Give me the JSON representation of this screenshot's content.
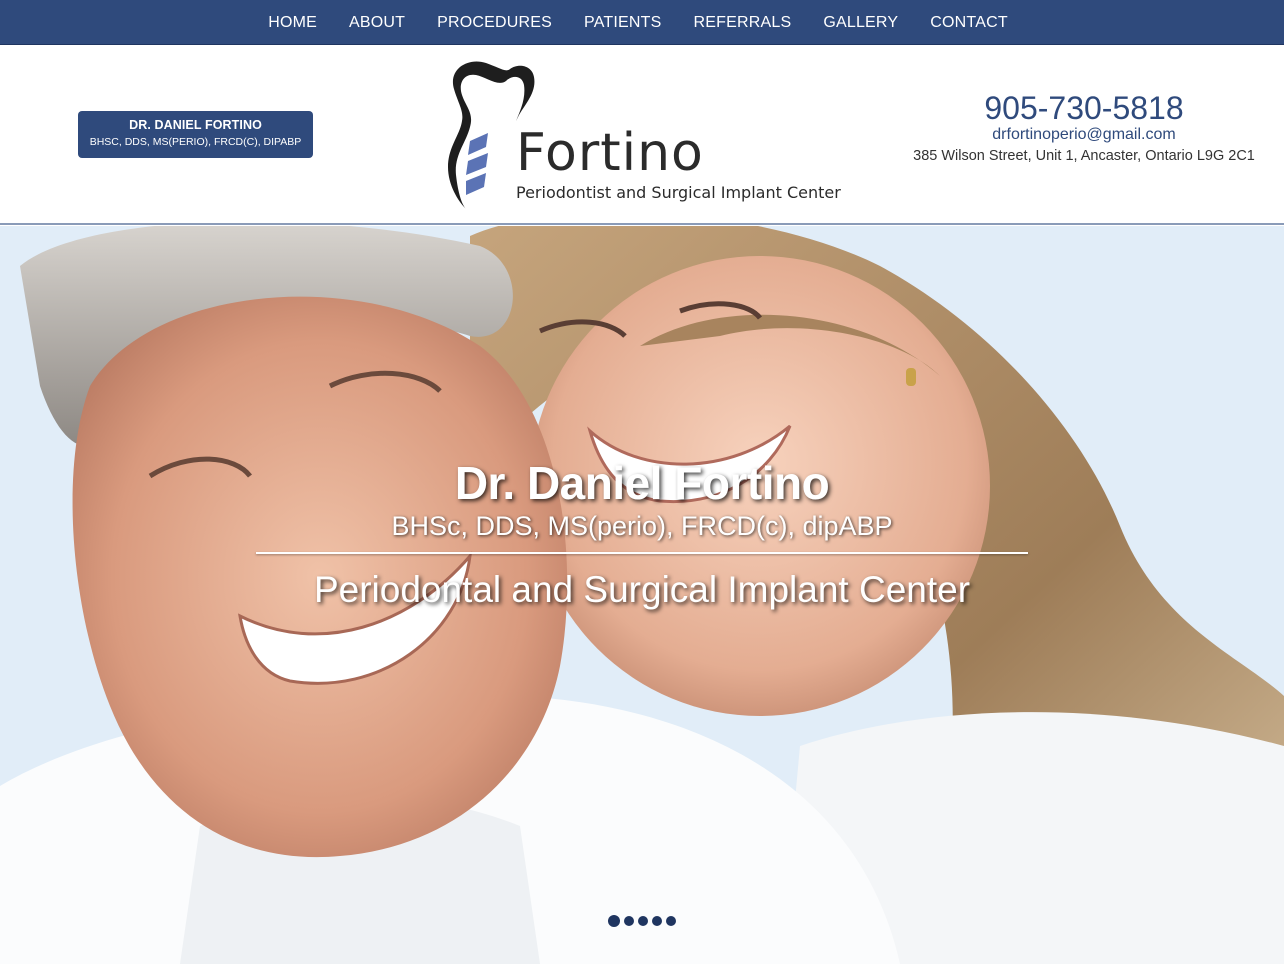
{
  "nav": {
    "items": [
      {
        "label": "HOME"
      },
      {
        "label": "ABOUT"
      },
      {
        "label": "PROCEDURES"
      },
      {
        "label": "PATIENTS"
      },
      {
        "label": "REFERRALS"
      },
      {
        "label": "GALLERY"
      },
      {
        "label": "CONTACT"
      }
    ]
  },
  "header": {
    "badge": {
      "name": "DR. DANIEL FORTINO",
      "credentials": "BHSC, DDS, MS(PERIO), FRCD(C), DIPABP"
    },
    "logo": {
      "wordmark": "Fortino",
      "tagline": "Periodontist and Surgical Implant Center"
    },
    "contact": {
      "phone": "905-730-5818",
      "email": "drfortinoperio@gmail.com",
      "address": "385 Wilson Street, Unit 1, Ancaster, Ontario L9G 2C1"
    }
  },
  "hero": {
    "title": "Dr. Daniel Fortino",
    "subtitle": "BHSc, DDS, MS(perio), FRCD(c), dipABP",
    "tagline": "Periodontal and Surgical Implant Center",
    "slide_count": 5,
    "active_slide": 1
  },
  "colors": {
    "brand_navy": "#2f4a7c",
    "logo_accent": "#5b73b5"
  }
}
